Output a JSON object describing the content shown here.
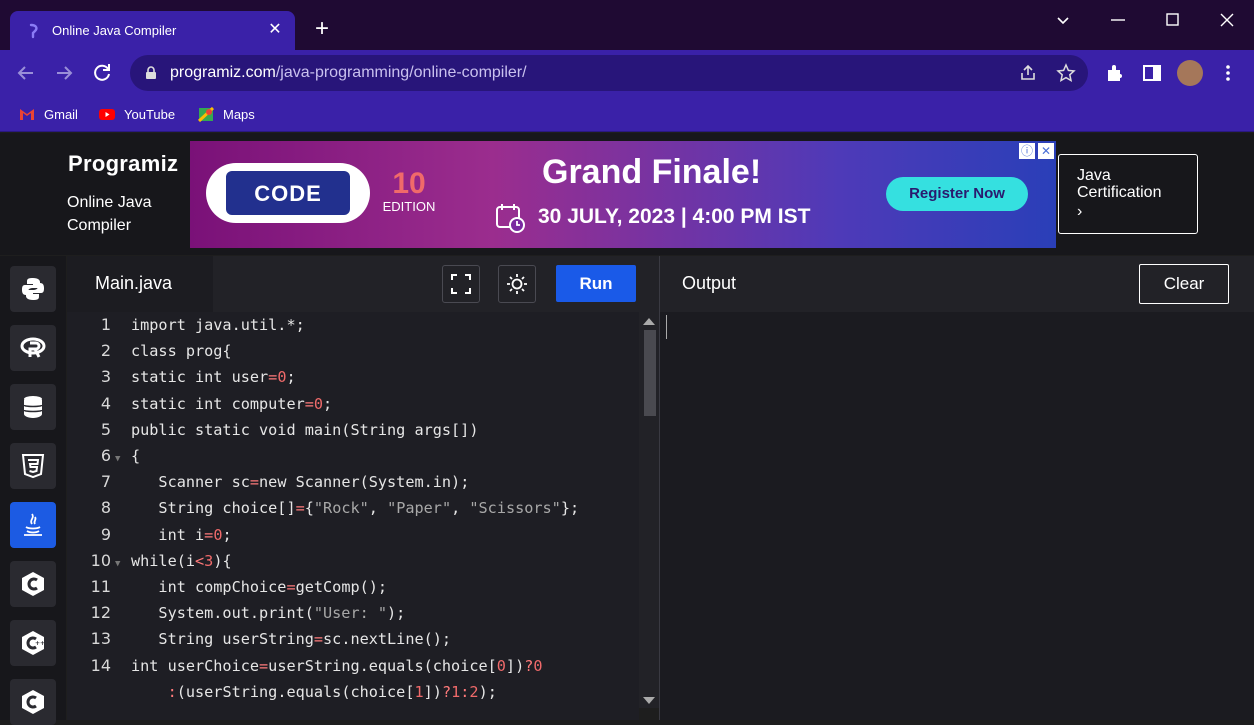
{
  "browser": {
    "tab_title": "Online Java Compiler",
    "url_host": "programiz.com",
    "url_path": "/java-programming/online-compiler/",
    "bookmarks": [
      {
        "label": "Gmail",
        "icon": "gmail-icon"
      },
      {
        "label": "YouTube",
        "icon": "youtube-icon"
      },
      {
        "label": "Maps",
        "icon": "maps-icon"
      }
    ]
  },
  "header": {
    "logo": "Programiz",
    "subtitle": "Online Java Compiler"
  },
  "ad": {
    "badge_text": "CODE",
    "edition_number": "10",
    "edition_label": "EDITION",
    "title": "Grand Finale!",
    "date": "30 JULY, 2023 | 4:00 PM IST",
    "cta": "Register Now"
  },
  "cert_button": {
    "label": "Java Certification"
  },
  "sidebar": {
    "languages": [
      {
        "name": "python",
        "icon": "python-icon"
      },
      {
        "name": "r",
        "icon": "r-icon"
      },
      {
        "name": "sql",
        "icon": "database-icon"
      },
      {
        "name": "html",
        "icon": "html5-icon"
      },
      {
        "name": "java",
        "icon": "java-icon",
        "active": true
      },
      {
        "name": "c",
        "icon": "c-icon"
      },
      {
        "name": "cpp",
        "icon": "cpp-icon"
      },
      {
        "name": "csharp",
        "icon": "csharp-icon"
      }
    ]
  },
  "editor": {
    "filename": "Main.java",
    "run_label": "Run",
    "lines": [
      {
        "n": "1",
        "fold": false,
        "code": "import java.util.*;"
      },
      {
        "n": "2",
        "fold": false,
        "code": "class prog{"
      },
      {
        "n": "3",
        "fold": false,
        "code": "static int user=0;"
      },
      {
        "n": "4",
        "fold": false,
        "code": "static int computer=0;"
      },
      {
        "n": "5",
        "fold": false,
        "code": "public static void main(String args[])"
      },
      {
        "n": "6",
        "fold": true,
        "code": "{"
      },
      {
        "n": "7",
        "fold": false,
        "code": "   Scanner sc=new Scanner(System.in);"
      },
      {
        "n": "8",
        "fold": false,
        "code": "   String choice[]={\"Rock\", \"Paper\", \"Scissors\"};"
      },
      {
        "n": "9",
        "fold": false,
        "code": "   int i=0;"
      },
      {
        "n": "10",
        "fold": true,
        "code": "while(i<3){"
      },
      {
        "n": "11",
        "fold": false,
        "code": "   int compChoice=getComp();"
      },
      {
        "n": "12",
        "fold": false,
        "code": "   System.out.print(\"User: \");"
      },
      {
        "n": "13",
        "fold": false,
        "code": "   String userString=sc.nextLine();"
      },
      {
        "n": "14",
        "fold": false,
        "code": "int userChoice=userString.equals(choice[0])?0"
      },
      {
        "n": "",
        "fold": false,
        "code": "    :(userString.equals(choice[1])?1:2);"
      }
    ]
  },
  "output": {
    "title": "Output",
    "clear_label": "Clear",
    "text": ""
  },
  "colors": {
    "tab_bg": "#3a21a8",
    "run_button": "#1a5ae8",
    "active_language": "#1c5be3",
    "ad_cta": "#35e0e0"
  }
}
